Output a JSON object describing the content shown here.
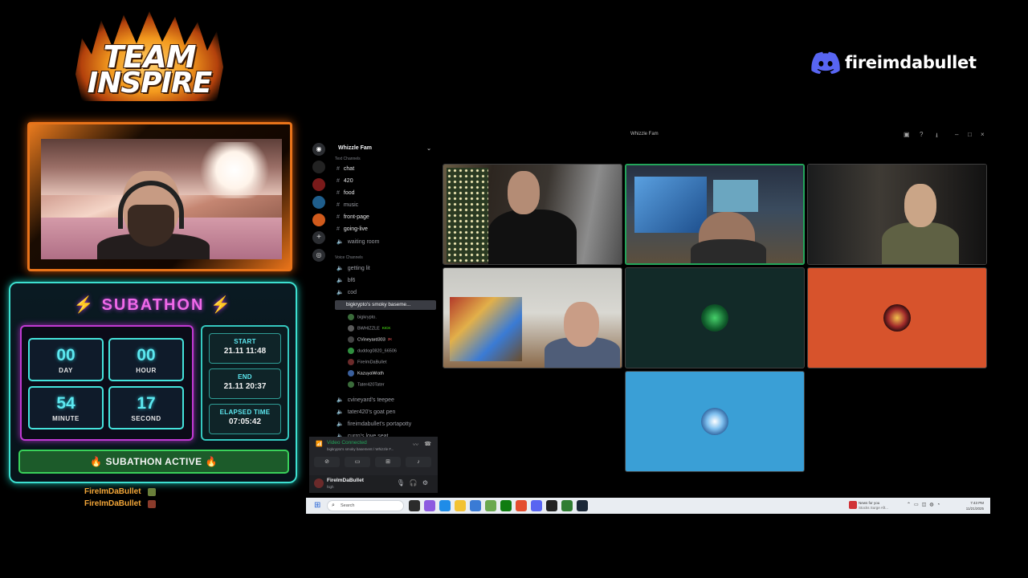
{
  "overlay": {
    "team_logo": {
      "line1": "TEAM",
      "line2": "INSPIRE"
    },
    "discord_handle": "fireimdabullet",
    "subathon": {
      "title": "SUBATHON",
      "timer": [
        {
          "value": "00",
          "label": "DAY"
        },
        {
          "value": "00",
          "label": "HOUR"
        },
        {
          "value": "54",
          "label": "MINUTE"
        },
        {
          "value": "17",
          "label": "SECOND"
        }
      ],
      "info": [
        {
          "label": "START",
          "value": "21.11 11:48"
        },
        {
          "label": "END",
          "value": "21.11 20:37"
        },
        {
          "label": "ELAPSED TIME",
          "value": "07:05:42"
        }
      ],
      "status": "SUBATHON ACTIVE"
    },
    "chat_names": [
      "FireImDaBullet",
      "FireImDaBullet"
    ]
  },
  "discord": {
    "window_title": "Whizzle Fam",
    "server_name": "Whizzle Fam",
    "text_category": "Text Channels",
    "text_channels": [
      "chat",
      "420",
      "food",
      "music",
      "front-page",
      "going-live",
      "waiting room"
    ],
    "voice_category": "Voice Channels",
    "voice_channels_top": [
      "getting lit",
      "bf6",
      "cod"
    ],
    "active_voice": "bigkrypto's smoky baseme...",
    "members": [
      {
        "name": "bigkrypto.",
        "tag": ""
      },
      {
        "name": "BWHIZZLE",
        "tag": "KICK"
      },
      {
        "name": "CVineyard303",
        "tag": "2K"
      },
      {
        "name": "duddog0820_66506",
        "tag": ""
      },
      {
        "name": "FireImDaBullet",
        "tag": ""
      },
      {
        "name": "KazuyaWrath",
        "tag": ""
      },
      {
        "name": "Tater420Tater",
        "tag": ""
      }
    ],
    "voice_channels_bottom": [
      "cvineyard's teepee",
      "tater420's goat pen",
      "fireimdabullet's portapotty",
      "curro's love seat"
    ],
    "voice_panel": {
      "status": "Video Connected",
      "location": "bigkrypto's smoky basement / Whizzle F..."
    },
    "user_panel": {
      "name": "FireImDaBullet",
      "status": "high"
    }
  },
  "taskbar": {
    "search_placeholder": "Search",
    "news_line1": "News for you",
    "news_line2": "Stocks Surge Aft...",
    "time": "7:43 PM",
    "date": "11/21/2025"
  },
  "colors": {
    "subathon_border": "#3de0d0",
    "timer_border": "#c03ad3",
    "active_green": "#39d15a",
    "discord_blurple": "#5865f2",
    "speaking_green": "#23a55a"
  }
}
